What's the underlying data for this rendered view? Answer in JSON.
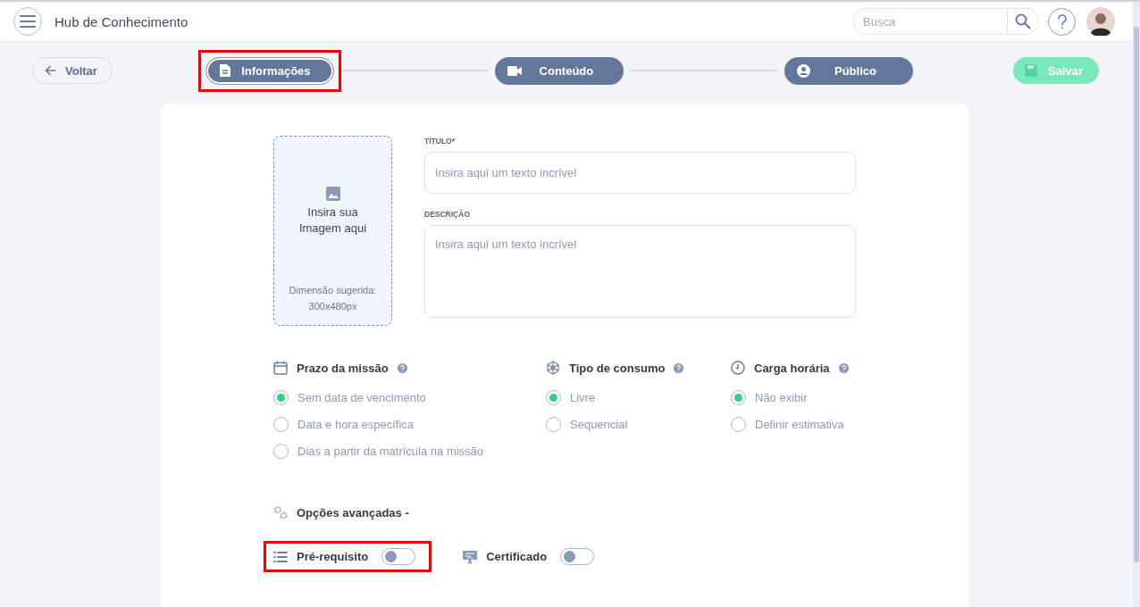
{
  "header": {
    "title": "Hub de Conhecimento",
    "search": {
      "placeholder": "Busca"
    }
  },
  "back_button": "Voltar",
  "steps": [
    {
      "label": "Informações",
      "selected": true,
      "highlighted": true
    },
    {
      "label": "Conteúdo",
      "selected": false,
      "highlighted": false
    },
    {
      "label": "Público",
      "selected": false,
      "highlighted": false
    }
  ],
  "save_button": {
    "label": "Salvar",
    "disabled": true
  },
  "image_upload": {
    "label": "Insira sua Imagem aqui",
    "hint": "Dimensão sugerida: 300x480px"
  },
  "fields": [
    {
      "kind": "input",
      "label": "TÍTULO*",
      "placeholder": "Insira aqui um texto incrível"
    },
    {
      "kind": "textarea",
      "label": "DESCRIÇÃO",
      "placeholder": "Insira aqui um texto incrível"
    }
  ],
  "option_groups": [
    {
      "title": "Prazo da missão",
      "options": [
        {
          "label": "Sem data de vencimento",
          "selected": true
        },
        {
          "label": "Data e hora específica",
          "selected": false
        },
        {
          "label": "Dias a partir da matrícula na missão",
          "selected": false
        }
      ]
    },
    {
      "title": "Tipo de consumo",
      "options": [
        {
          "label": "Livre",
          "selected": true
        },
        {
          "label": "Sequencial",
          "selected": false
        }
      ]
    },
    {
      "title": "Carga horária",
      "options": [
        {
          "label": "Não exibir",
          "selected": true
        },
        {
          "label": "Definir estimativa",
          "selected": false
        }
      ]
    }
  ],
  "advanced_title": "Opções avançadas -",
  "toggles": [
    {
      "label": "Pré-requisito",
      "on": false,
      "highlighted": true
    },
    {
      "label": "Certificado",
      "on": false,
      "highlighted": false
    }
  ]
}
